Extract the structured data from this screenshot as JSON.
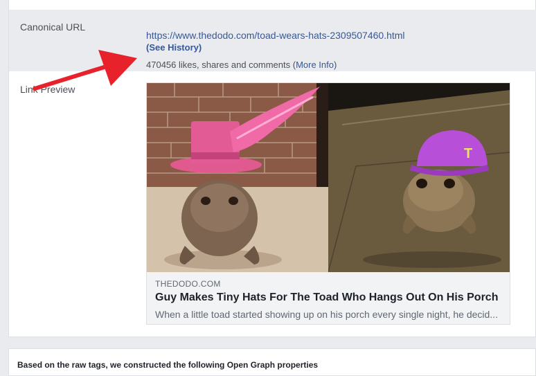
{
  "canonical": {
    "label": "Canonical URL",
    "url": "https://www.thedodo.com/toad-wears-hats-2309507460.html",
    "see_history": "(See History)",
    "stats_text": "470456 likes, shares and comments (",
    "more_info": "More Info",
    "stats_close": ")"
  },
  "link_preview": {
    "label": "Link Preview",
    "domain": "THEDODO.COM",
    "title": "Guy Makes Tiny Hats For The Toad Who Hangs Out On His Porch",
    "description": "When a little toad started showing up on his porch every single night, he decid..."
  },
  "og_section": {
    "heading": "Based on the raw tags, we constructed the following Open Graph properties"
  },
  "colors": {
    "link": "#365899",
    "arrow": "#e8222a",
    "row_highlight": "#e9ebee"
  }
}
